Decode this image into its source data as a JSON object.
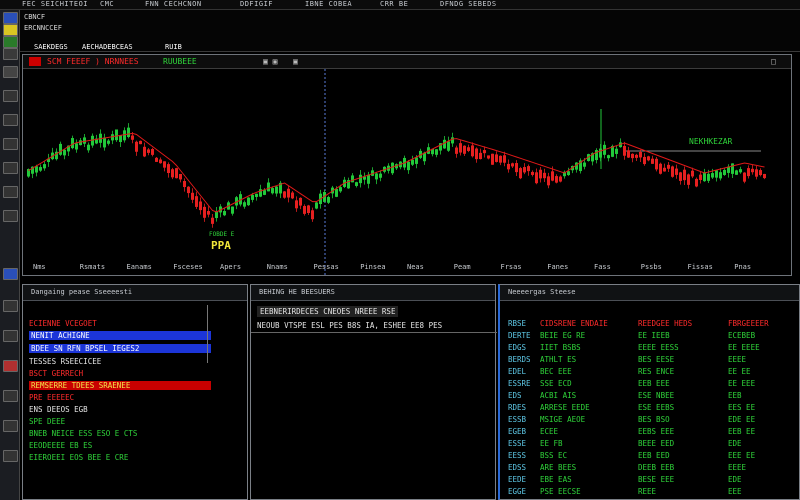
{
  "menubar": {
    "items": [
      "FEC SEICHITEOI",
      "CMC",
      "FNN CECHCNON",
      "DDFIGIF",
      "IBNE COBEA",
      "CRR BE",
      "DFNDG SEBEDS"
    ]
  },
  "topbar": {
    "line1": "CBNCF",
    "line2": "ERCNNCCEF",
    "items": [
      "SAEKDEGS",
      "AECHADEBCEAS",
      "RUIB"
    ]
  },
  "chart": {
    "title_left": "SCM FEEEF ) NRNNEES",
    "title_right": "RUUBEEE",
    "annotation_right": "NEKHKEZAR",
    "annotation_low": "PPA",
    "annotation_low_sub": "FOBDE E",
    "x_labels": [
      "Nms",
      "Rsmats",
      "Eanams",
      "Fsceses",
      "Apers",
      "Nnams",
      "Pessas",
      "Pinsea",
      "Neas",
      "Peam",
      "Frsas",
      "Fanes",
      "Fass",
      "Pssbs",
      "Fissas",
      "Pnas"
    ]
  },
  "panel1": {
    "title": "Dangaing pease Sseeeesti",
    "rows": [
      {
        "text": "ECIENNE VCEGOET",
        "style": "red"
      },
      {
        "text": "NENIT ACHIGNE",
        "style": "blue"
      },
      {
        "text": "BDEE  SN  RFN   BPSEL IEGES2",
        "style": "blue"
      },
      {
        "text": "TESSES RSEECICEE",
        "style": "white"
      },
      {
        "text": "BSCT GERRECH",
        "style": "red"
      },
      {
        "text": "REMSERRE TDEES SRAENEE",
        "style": "redbar"
      },
      {
        "text": "PRE EEEEEC",
        "style": "red"
      },
      {
        "text": "ENS  DEEOS EGB",
        "style": "white"
      },
      {
        "text": "SPE  DEEE",
        "style": "green"
      },
      {
        "text": "BNEB NEICE  ESS ESO  E CTS",
        "style": "green"
      },
      {
        "text": "EEODEEEE    EB   ES",
        "style": "green"
      },
      {
        "text": "EIEROEEI EOS  BEE  E  CRE",
        "style": "green"
      }
    ]
  },
  "panel2": {
    "title": "BEHING HE BEESUERS",
    "header_row": "EEBNERIRDECES  CNEOES  NREEE RSE",
    "row2": "NEOUB  VTSPE  ESL  PES  B8S  IA,    ESHEE EE8  PES"
  },
  "panel3": {
    "title": "Neeeergas Steese",
    "col1": [
      "RBSE",
      "DERTE",
      "EDGS",
      "BERDS",
      "EDEL",
      "ESSRE",
      "EDS",
      "RDES",
      "ESSB",
      "EGEB",
      "ESSE",
      "EESS",
      "EDSS",
      "EEDE",
      "EGGE"
    ],
    "col2": [
      "CIDSRENE ENDAIE",
      "BEIE EG RE",
      "IIET  BSBS",
      "ATHLT ES",
      "BEC EEE",
      "SSE  ECD",
      "ACBI  AIS",
      "ARRESE EEDE",
      "MSIGE AEOE",
      "ECEE",
      "EE  FB",
      "BSS  EC",
      "ARE BEES",
      "EBE EAS",
      "PSE  EECSE"
    ],
    "col3": [
      "REEDGEE HEDS",
      "EE IEEB",
      "EEEE EESS",
      "BES EESE",
      "RES ENCE",
      "EEB  EEE",
      "ESE  NBEE",
      "ESE  EEBS",
      "BES  BSO",
      "EEBS EEE",
      "BEEE EED",
      "EEB EED",
      "DEEB EEB",
      "BESE EEE",
      "REEE"
    ],
    "col4": [
      "FBRGEEEER",
      "ECEBEB",
      "EE EEEE",
      "EEEE",
      "EE  EE",
      "EE EEE",
      "EEB",
      "EES EE",
      "EDE EE",
      "EEB EE",
      "EDE",
      "EEE  EE",
      "EEEE",
      "EDE",
      "EEE"
    ]
  },
  "colors": {
    "up": "#22c93a",
    "down": "#e62020",
    "accent_red": "#d00000",
    "accent_blue": "#1c35d8",
    "ma": "#e01818"
  }
}
